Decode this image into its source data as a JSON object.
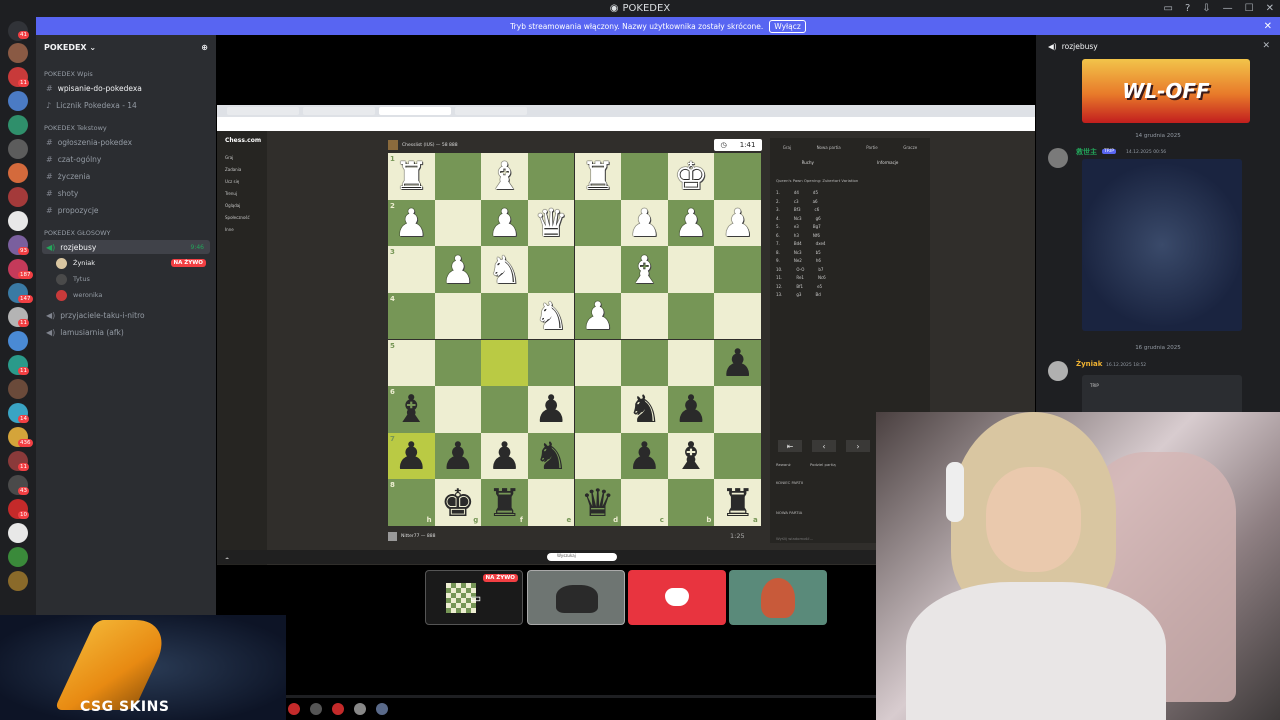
{
  "window": {
    "title": "POKEDEX"
  },
  "banner": {
    "text": "Tryb streamowania włączony. Nazwy użytkownika zostały skrócone.",
    "button": "Wyłącz"
  },
  "server": {
    "name": "POKEDEX"
  },
  "categories": {
    "wpis": "POKEDEX Wpis",
    "tekstowy": "POKEDEX Tekstowy",
    "glosowy": "POKEDEX GŁOSOWY"
  },
  "channels": {
    "wpisanie": "wpisanie-do-pokedexa",
    "licznik": "Licznik Pokedexa - 14",
    "ogloszenia": "ogłoszenia-pokedex",
    "czat": "czat-ogólny",
    "zyczenia": "życzenia",
    "shoty": "shoty",
    "propozycje": "propozycje",
    "rozjebusy": "rozjebusy",
    "rozjebusy_time": "9:46",
    "przyjaciele": "przyjaciele-taku-i-nitro",
    "lamusiarnia": "lamusiarnia (afk)"
  },
  "voice_users": [
    {
      "name": "Żyniak",
      "live": "NA ŻYWO"
    },
    {
      "name": "Tytus"
    },
    {
      "name": "weronika"
    }
  ],
  "rail_badges": [
    "41",
    "11",
    "93",
    "187",
    "147",
    "11",
    "11",
    "14",
    "436",
    "11",
    "43",
    "10"
  ],
  "shared_screen": {
    "site": "Chess.com",
    "nav": [
      "Graj",
      "Zadania",
      "Ucz się",
      "Trenuj",
      "Oglądaj",
      "Społeczność",
      "Inne"
    ],
    "top_player": "Chesslist (IUS) — 58 888",
    "top_clock": "1:41",
    "bottom_player": "Nitter77 — 888",
    "bottom_clock": "1:25",
    "move_tabs": [
      "Graj",
      "Nowa partia",
      "Partie",
      "Gracze"
    ],
    "sub_tabs": [
      "Ruchy",
      "Informacje"
    ],
    "opening": "Queen's Pawn Opening: Zukertort Variation",
    "moves": [
      [
        "1.",
        "d4",
        "d5"
      ],
      [
        "2.",
        "c3",
        "a6"
      ],
      [
        "3.",
        "Bf3",
        "c6"
      ],
      [
        "4.",
        "Nc3",
        "g6"
      ],
      [
        "5.",
        "e3",
        "Bg7"
      ],
      [
        "6.",
        "h3",
        "Nf6"
      ],
      [
        "7.",
        "Bd4",
        "dxe4"
      ],
      [
        "8.",
        "Nc3",
        "b5"
      ],
      [
        "9.",
        "Ne2",
        "h6"
      ],
      [
        "10.",
        "O-O",
        "b7"
      ],
      [
        "11.",
        "Re1",
        "Nc6"
      ],
      [
        "12.",
        "Bf1",
        "e5"
      ],
      [
        "13.",
        "g3",
        "Bd"
      ]
    ],
    "chat_lines": [
      "Rewanż",
      "Podziel partią",
      "KONIEC PARTII",
      "NOWA PARTIA",
      "Wyślij wiadomość..."
    ],
    "taskbar_search": "Wyszukaj"
  },
  "board": {
    "files_bottom": [
      "h",
      "g",
      "f",
      "e",
      "d",
      "c",
      "b",
      "a"
    ],
    "ranks": [
      "1",
      "2",
      "3",
      "4",
      "5",
      "6",
      "7",
      "8"
    ],
    "pieces": [
      [
        "wR",
        "",
        "wB",
        "",
        "wR",
        "",
        "wK",
        ""
      ],
      [
        "wP",
        "",
        "wP",
        "wQ",
        "",
        "wP",
        "wP",
        "wP"
      ],
      [
        "",
        "wP",
        "wN",
        "",
        "",
        "wB",
        "",
        ""
      ],
      [
        "",
        "",
        "",
        "wN",
        "wP",
        "",
        "",
        ""
      ],
      [
        "",
        "",
        "",
        "",
        "",
        "",
        "",
        "bP"
      ],
      [
        "bB",
        "",
        "",
        "bP",
        "",
        "bN",
        "bP",
        ""
      ],
      [
        "bP",
        "bP",
        "bP",
        "bN",
        "",
        "bP",
        "bB",
        ""
      ],
      [
        "",
        "bK",
        "bR",
        "",
        "bQ",
        "",
        "",
        "bR"
      ]
    ],
    "highlights": [
      "4-2",
      "6-0"
    ]
  },
  "tiles": [
    {
      "name": "shared-screen-tile",
      "live": "NA ŻYWO",
      "bg": "#1a1a1a"
    },
    {
      "name": "car-tile",
      "bg": "#6e7572"
    },
    {
      "name": "discord-tile",
      "bg": "#e8343f"
    },
    {
      "name": "avatar-tile",
      "bg": "#5a8a7a"
    }
  ],
  "right_panel": {
    "channel": "rozjebusy",
    "banner_text": "WL-OFF",
    "date1": "14 grudnia 2025",
    "user1": "救世主",
    "user1_tag": "TRIP",
    "user1_time": "14.12.2025 00:56",
    "date2": "16 grudnia 2025",
    "user2": "Żyniak",
    "user2_time": "16.12.2025 18:52",
    "embed_tag": "TRIP"
  },
  "promo": {
    "text": "CSG SKINS"
  },
  "colors": {
    "discord_blurple": "#5865f2",
    "live_red": "#f23f43",
    "board_light": "#eeeed2",
    "board_dark": "#769656",
    "board_highlight": "#baca44"
  }
}
